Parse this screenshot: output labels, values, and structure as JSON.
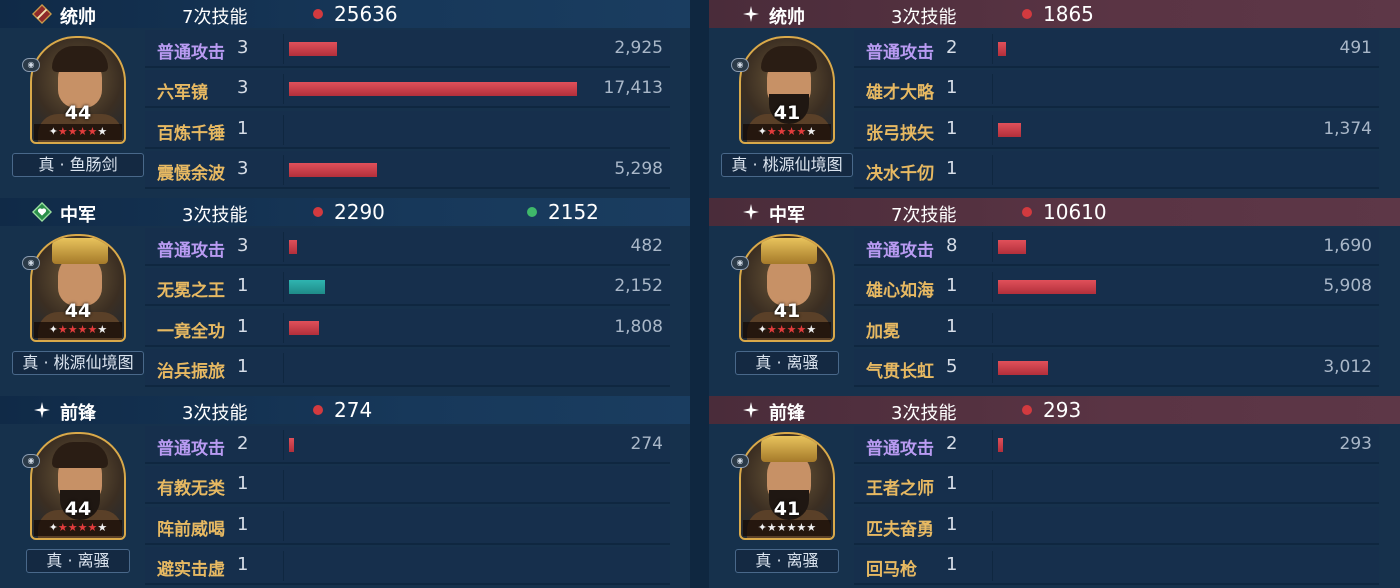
{
  "colors": {
    "damage_dot": "#d23a3f",
    "heal_dot": "#3fb86a",
    "skill_name": "#e7b962",
    "basic_attack_name": "#b99bf2",
    "bar_damage": "#d0414b",
    "bar_heal": "#25a3a0"
  },
  "left": {
    "roles": [
      {
        "icon": "sword-badge-icon",
        "role": "统帅",
        "skills": "7次技能",
        "damage": "25636",
        "heal": "",
        "level": "44",
        "stars": 5,
        "weapon": "真 · 鱼肠剑",
        "rows": [
          {
            "name": "普通攻击",
            "count": "3",
            "value": "2,925",
            "fraction": 0.168,
            "type": "damage",
            "attack": true
          },
          {
            "name": "六军镜",
            "count": "3",
            "value": "17,413",
            "fraction": 1.0,
            "type": "damage",
            "attack": false
          },
          {
            "name": "百炼千锤",
            "count": "1",
            "value": "",
            "fraction": 0,
            "type": "damage",
            "attack": false
          },
          {
            "name": "震慑余波",
            "count": "3",
            "value": "5,298",
            "fraction": 0.304,
            "type": "damage",
            "attack": false
          }
        ]
      },
      {
        "icon": "heart-badge-icon",
        "role": "中军",
        "skills": "3次技能",
        "damage": "2290",
        "heal": "2152",
        "level": "44",
        "stars": 5,
        "weapon": "真 · 桃源仙境图",
        "rows": [
          {
            "name": "普通攻击",
            "count": "3",
            "value": "482",
            "fraction": 0.028,
            "type": "damage",
            "attack": true
          },
          {
            "name": "无冕之王",
            "count": "1",
            "value": "2,152",
            "fraction": 0.124,
            "type": "heal",
            "attack": false
          },
          {
            "name": "一竟全功",
            "count": "1",
            "value": "1,808",
            "fraction": 0.104,
            "type": "damage",
            "attack": false
          },
          {
            "name": "治兵振旅",
            "count": "1",
            "value": "",
            "fraction": 0,
            "type": "damage",
            "attack": false
          }
        ]
      },
      {
        "icon": "sparkle-icon",
        "role": "前锋",
        "skills": "3次技能",
        "damage": "274",
        "heal": "",
        "level": "44",
        "stars": 5,
        "weapon": "真 · 离骚",
        "rows": [
          {
            "name": "普通攻击",
            "count": "2",
            "value": "274",
            "fraction": 0.016,
            "type": "damage",
            "attack": true
          },
          {
            "name": "有教无类",
            "count": "1",
            "value": "",
            "fraction": 0,
            "type": "damage",
            "attack": false
          },
          {
            "name": "阵前威喝",
            "count": "1",
            "value": "",
            "fraction": 0,
            "type": "damage",
            "attack": false
          },
          {
            "name": "避实击虚",
            "count": "1",
            "value": "",
            "fraction": 0,
            "type": "damage",
            "attack": false
          }
        ]
      }
    ]
  },
  "right": {
    "roles": [
      {
        "icon": "sparkle-icon",
        "role": "统帅",
        "skills": "3次技能",
        "damage": "1865",
        "heal": "",
        "level": "41",
        "stars": 5,
        "weapon": "真 · 桃源仙境图",
        "rows": [
          {
            "name": "普通攻击",
            "count": "2",
            "value": "491",
            "fraction": 0.028,
            "type": "damage",
            "attack": true
          },
          {
            "name": "雄才大略",
            "count": "1",
            "value": "",
            "fraction": 0,
            "type": "damage",
            "attack": false
          },
          {
            "name": "张弓挟矢",
            "count": "1",
            "value": "1,374",
            "fraction": 0.079,
            "type": "damage",
            "attack": false
          },
          {
            "name": "决水千仞",
            "count": "1",
            "value": "",
            "fraction": 0,
            "type": "damage",
            "attack": false
          }
        ]
      },
      {
        "icon": "sparkle-icon",
        "role": "中军",
        "skills": "7次技能",
        "damage": "10610",
        "heal": "",
        "level": "41",
        "stars": 5,
        "weapon": "真 · 离骚",
        "rows": [
          {
            "name": "普通攻击",
            "count": "8",
            "value": "1,690",
            "fraction": 0.097,
            "type": "damage",
            "attack": true
          },
          {
            "name": "雄心如海",
            "count": "1",
            "value": "5,908",
            "fraction": 0.339,
            "type": "damage",
            "attack": false
          },
          {
            "name": "加冕",
            "count": "1",
            "value": "",
            "fraction": 0,
            "type": "damage",
            "attack": false
          },
          {
            "name": "气贯长虹",
            "count": "5",
            "value": "3,012",
            "fraction": 0.173,
            "type": "damage",
            "attack": false
          }
        ]
      },
      {
        "icon": "sparkle-icon",
        "role": "前锋",
        "skills": "3次技能",
        "damage": "293",
        "heal": "",
        "level": "41",
        "stars": 6,
        "weapon": "真 · 离骚",
        "rows": [
          {
            "name": "普通攻击",
            "count": "2",
            "value": "293",
            "fraction": 0.017,
            "type": "damage",
            "attack": true
          },
          {
            "name": "王者之师",
            "count": "1",
            "value": "",
            "fraction": 0,
            "type": "damage",
            "attack": false
          },
          {
            "name": "匹夫奋勇",
            "count": "1",
            "value": "",
            "fraction": 0,
            "type": "damage",
            "attack": false
          },
          {
            "name": "回马枪",
            "count": "1",
            "value": "",
            "fraction": 0,
            "type": "damage",
            "attack": false
          }
        ]
      }
    ]
  }
}
